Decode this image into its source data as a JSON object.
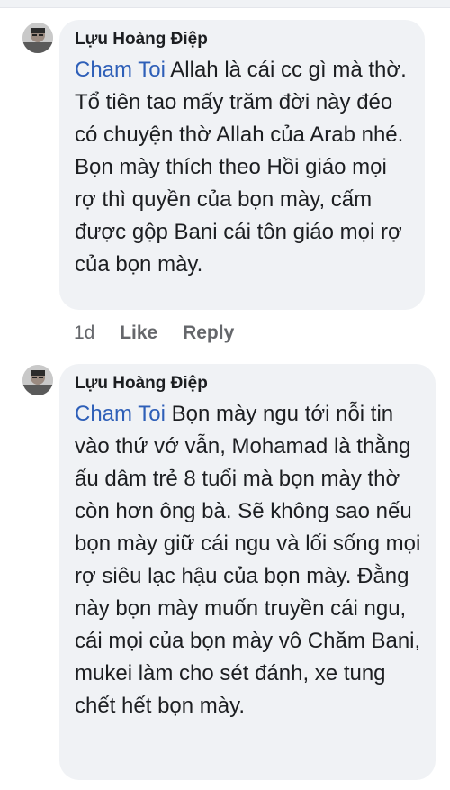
{
  "comments": [
    {
      "author": "Lựu Hoàng Điệp",
      "mention": "Cham Toi",
      "text": "Allah là cái cc gì mà thờ. Tổ tiên tao mấy trăm đời này đéo có chuyện thờ Allah của Arab nhé. Bọn mày thích theo Hồi giáo mọi rợ thì quyền của bọn mày, cấm được gộp Bani cái tôn giáo mọi rợ của bọn mày.",
      "time": "1d",
      "like_label": "Like",
      "reply_label": "Reply"
    },
    {
      "author": "Lựu Hoàng Điệp",
      "mention": "Cham Toi",
      "text": "Bọn mày ngu tới nỗi tin vào thứ vớ vẫn, Mohamad là thằng ấu dâm trẻ 8 tuổi mà bọn mày thờ còn hơn ông bà. Sẽ không sao nếu bọn mày giữ cái ngu và lối sống mọi rợ siêu lạc hậu của bọn mày. Đằng này bọn mày muốn truyền cái ngu, cái mọi của bọn mày vô Chăm Bani, mukei làm cho sét đánh, xe tung chết hết bọn mày."
    }
  ]
}
